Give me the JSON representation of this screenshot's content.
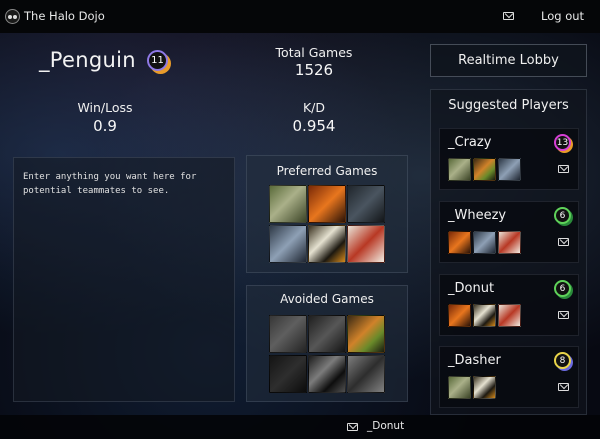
{
  "app": {
    "title": "The Halo Dojo",
    "logout_label": "Log out"
  },
  "profile": {
    "username": "_Penguin",
    "rank": "11",
    "total_games_label": "Total Games",
    "total_games_value": "1526",
    "winloss_label": "Win/Loss",
    "winloss_value": "0.9",
    "kd_label": "K/D",
    "kd_value": "0.954",
    "bio_placeholder": "Enter anything you want here for potential teammates to see."
  },
  "preferred": {
    "title": "Preferred Games"
  },
  "avoided": {
    "title": "Avoided Games"
  },
  "lobby": {
    "label": "Realtime Lobby"
  },
  "suggested": {
    "title": "Suggested Players",
    "players": [
      {
        "name": "_Crazy",
        "rank": "13"
      },
      {
        "name": "_Wheezy",
        "rank": "6"
      },
      {
        "name": "_Donut",
        "rank": "6"
      },
      {
        "name": "_Dasher",
        "rank": "8"
      }
    ]
  },
  "footer": {
    "user": "_Donut"
  },
  "colors": {
    "badge_penguin": "#8f79e6",
    "badge_crazy": "#d63fd6",
    "badge_wheezy": "#5fd25a",
    "badge_donut": "#5fd25a",
    "badge_dasher": "#e8d44a"
  },
  "icons": [
    "logo-icon",
    "mail-icon",
    "game-cover-thumbnail"
  ]
}
